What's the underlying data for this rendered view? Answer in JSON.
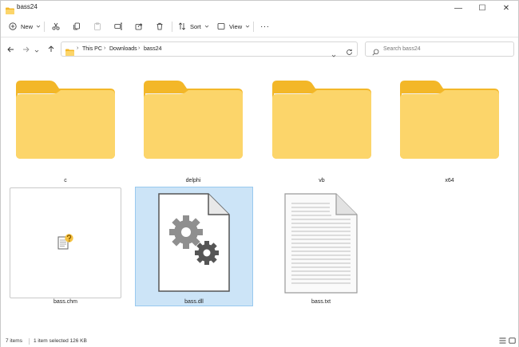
{
  "window": {
    "title": "bass24"
  },
  "titlebar": {
    "minimize": "—",
    "maximize": "☐",
    "close": "✕"
  },
  "toolbar": {
    "new_label": "New",
    "sort_label": "Sort",
    "view_label": "View",
    "more_label": "···"
  },
  "address": {
    "crumbs": [
      "This PC",
      "Downloads",
      "bass24"
    ]
  },
  "search": {
    "placeholder": "Search bass24"
  },
  "items": [
    {
      "name": "c",
      "type": "folder"
    },
    {
      "name": "delphi",
      "type": "folder"
    },
    {
      "name": "vb",
      "type": "folder"
    },
    {
      "name": "x64",
      "type": "folder"
    },
    {
      "name": "bass.chm",
      "type": "chm"
    },
    {
      "name": "bass.dll",
      "type": "dll",
      "selected": true
    },
    {
      "name": "bass.txt",
      "type": "txt"
    }
  ],
  "status": {
    "count": "7 items",
    "selection": "1 item selected  126 KB"
  },
  "colors": {
    "selection_bg": "#cce4f7",
    "folder_back": "#f3b728",
    "folder_front": "#fcd56a"
  }
}
